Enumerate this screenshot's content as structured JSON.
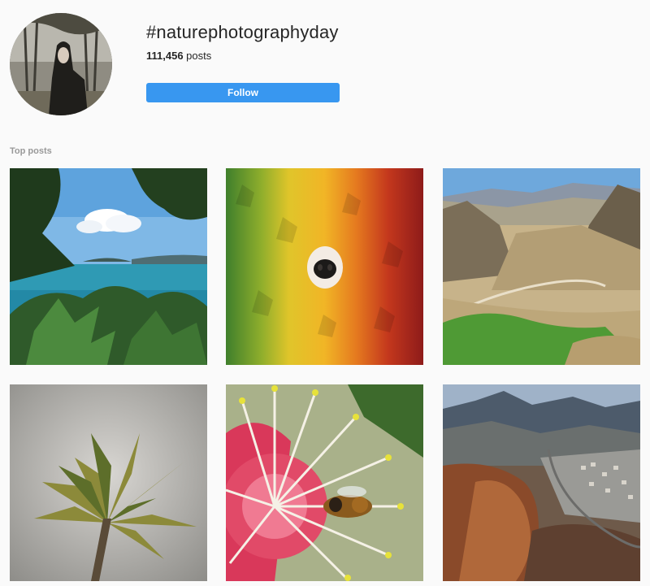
{
  "hashtag": {
    "title": "#naturephotographyday",
    "post_count": "111,456",
    "post_count_suffix": " posts"
  },
  "follow_button": {
    "label": "Follow"
  },
  "section": {
    "label": "Top posts"
  },
  "colors": {
    "accent": "#3897f0",
    "muted_label": "#999999"
  },
  "posts": [
    {
      "subject": "seaside-view"
    },
    {
      "subject": "autumn-leaves-dog-nose"
    },
    {
      "subject": "mountain-valley-road"
    },
    {
      "subject": "leaf-bud"
    },
    {
      "subject": "bee-on-flower"
    },
    {
      "subject": "aerial-mountain-town"
    }
  ]
}
